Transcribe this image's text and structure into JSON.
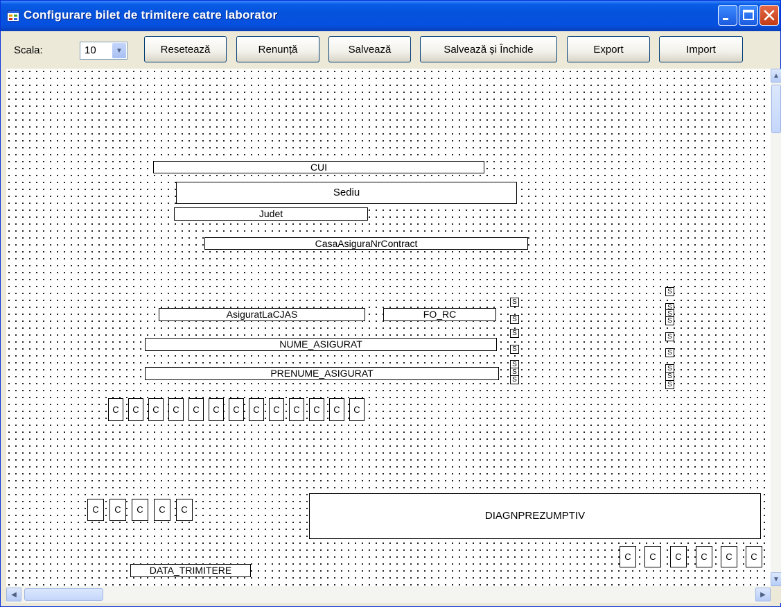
{
  "window": {
    "title": "Configurare bilet de trimitere catre laborator"
  },
  "toolbar": {
    "scale_label": "Scala:",
    "scale_value": "10",
    "buttons": [
      "Resetează",
      "Renunță",
      "Salvează",
      "Salvează și Închide",
      "Export",
      "Import"
    ]
  },
  "fields": {
    "cui": "CUI",
    "sediu": "Sediu",
    "judet": "Judet",
    "casa": "CasaAsiguraNrContract",
    "asigurat_cjas": "AsiguratLaCJAS",
    "fo_rc": "FO_RC",
    "nume": "NUME_ASIGURAT",
    "prenume": "PRENUME_ASIGURAT",
    "diag": "DIAGNPREZUMPTIV",
    "data_trimitere": "DATA_TRIMITERE"
  },
  "cells": {
    "c": "C",
    "s": "S"
  },
  "icons": {
    "app": "app-icon",
    "minimize": "minimize-icon",
    "maximize": "maximize-icon",
    "close": "close-icon",
    "dropdown": "chevron-down-icon"
  },
  "colors": {
    "titlebar": "#0553dc",
    "close_button": "#c23c15",
    "window_bg": "#ece9d8"
  }
}
